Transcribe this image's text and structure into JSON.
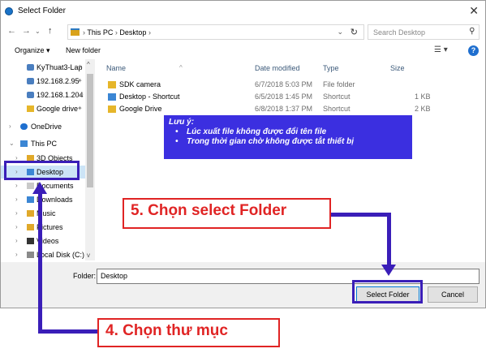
{
  "window": {
    "title": "Select Folder"
  },
  "address": {
    "path_parts": [
      "This PC",
      "Desktop"
    ],
    "search_placeholder": "Search Desktop"
  },
  "toolbar": {
    "organize": "Organize ▾",
    "new_folder": "New folder"
  },
  "nav_pane": {
    "items": [
      {
        "label": "KyThuat3-Lap",
        "pinned": true,
        "indent": 1
      },
      {
        "label": "192.168.2.95",
        "pinned": true,
        "indent": 1
      },
      {
        "label": "192.168.1.204",
        "pinned": true,
        "indent": 1
      },
      {
        "label": "Google drive",
        "pinned": true,
        "indent": 1
      },
      {
        "label": "OneDrive",
        "pinned": false,
        "indent": 0
      },
      {
        "label": "This PC",
        "pinned": false,
        "indent": 0
      },
      {
        "label": "3D Objects",
        "pinned": false,
        "indent": 1
      },
      {
        "label": "Desktop",
        "pinned": false,
        "indent": 1
      },
      {
        "label": "Documents",
        "pinned": false,
        "indent": 1
      },
      {
        "label": "Downloads",
        "pinned": false,
        "indent": 1
      },
      {
        "label": "Music",
        "pinned": false,
        "indent": 1
      },
      {
        "label": "Pictures",
        "pinned": false,
        "indent": 1
      },
      {
        "label": "Videos",
        "pinned": false,
        "indent": 1
      },
      {
        "label": "Local Disk (C:)",
        "pinned": false,
        "indent": 1
      }
    ]
  },
  "files": {
    "columns": [
      "Name",
      "Date modified",
      "Type",
      "Size"
    ],
    "rows": [
      {
        "name": "SDK camera",
        "date": "6/7/2018 5:03 PM",
        "type": "File folder",
        "size": ""
      },
      {
        "name": "Desktop - Shortcut",
        "date": "6/5/2018 1:45 PM",
        "type": "Shortcut",
        "size": "1 KB"
      },
      {
        "name": "Google Drive",
        "date": "6/8/2018 1:37 PM",
        "type": "Shortcut",
        "size": "2 KB"
      }
    ]
  },
  "footer": {
    "folder_label": "Folder:",
    "folder_value": "Desktop",
    "select_label": "Select Folder",
    "cancel_label": "Cancel"
  },
  "note": {
    "title": "Lưu ý:",
    "lines": [
      "Lúc xuất file không được đổi tên file",
      "Trong thời gian chờ không được tắt thiết bị"
    ]
  },
  "callouts": {
    "step5": "5. Chọn select Folder",
    "step4": "4. Chọn thư mục"
  },
  "colors": {
    "annotation_blue": "#3a1eb8",
    "callout_red": "#e02424",
    "note_bg": "#3b2fe0"
  }
}
